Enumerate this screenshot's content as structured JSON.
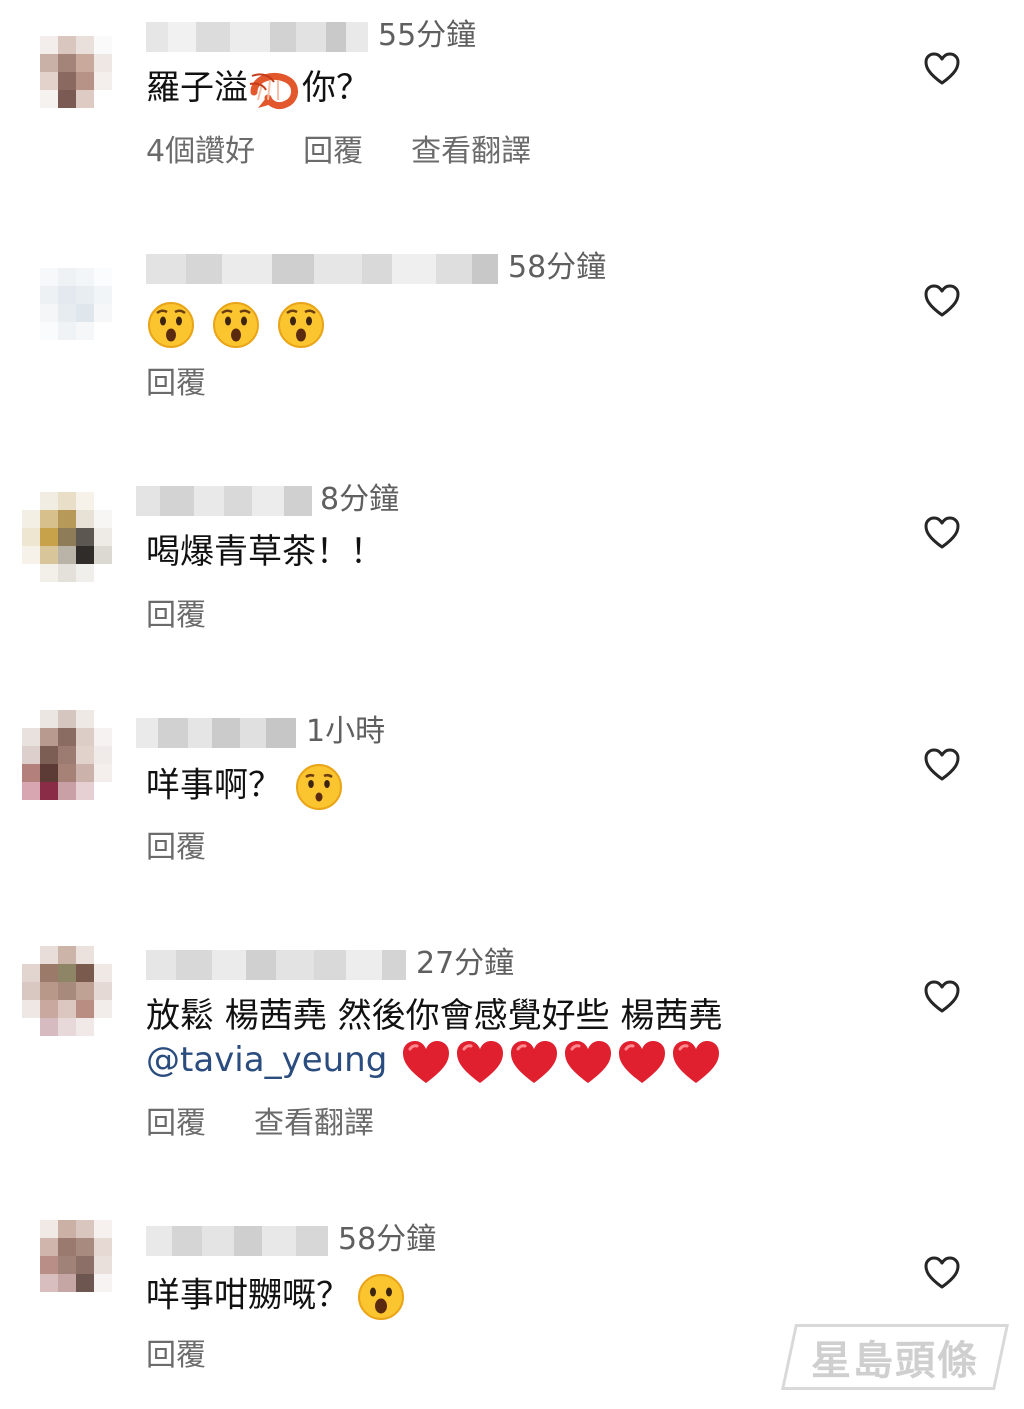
{
  "comments": [
    {
      "time": "55分鐘",
      "text": "羅子溢",
      "text_after": "你？",
      "emoji": "shrimp-emoji",
      "actions": [
        "4個讚好",
        "回覆",
        "查看翻譯"
      ]
    },
    {
      "time": "58分鐘",
      "text": "",
      "emoji": "hushed-face-emoji x3",
      "actions": [
        "回覆"
      ]
    },
    {
      "time": "8分鐘",
      "text": "喝爆青草茶！！",
      "actions": [
        "回覆"
      ]
    },
    {
      "time": "1小時",
      "text": "咩事啊？",
      "emoji": "hushed-face-emoji",
      "actions": [
        "回覆"
      ]
    },
    {
      "time": "27分鐘",
      "text": "放鬆 楊茜堯 然後你會感覺好些  楊茜堯",
      "mention": "@tavia_yeung",
      "emoji": "red-heart-emoji x6",
      "actions": [
        "回覆",
        "查看翻譯"
      ]
    },
    {
      "time": "58分鐘",
      "text": "咩事咁嬲嘅？",
      "emoji": "astonished-face-emoji",
      "actions": [
        "回覆"
      ]
    }
  ],
  "watermark": "星島頭條",
  "icons": {
    "like": "heart-outline-icon"
  },
  "colors": {
    "mention": "#2b4c7e",
    "meta_text": "#6b6b6b",
    "heart_emoji": "#e0202e"
  }
}
